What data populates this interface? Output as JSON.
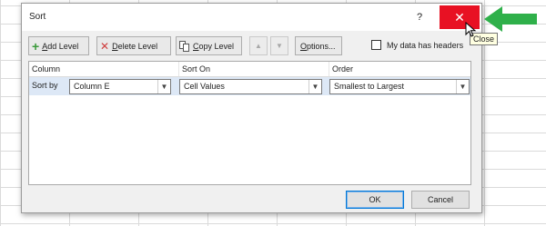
{
  "dialog": {
    "title": "Sort",
    "help_label": "?",
    "close_label": "✕"
  },
  "toolbar": {
    "add_level": {
      "underline": "A",
      "rest": "dd Level"
    },
    "delete_level": {
      "underline": "D",
      "rest": "elete Level"
    },
    "copy_level": {
      "underline": "C",
      "rest": "opy Level"
    },
    "move_up": "▲",
    "move_down": "▼",
    "options": {
      "underline": "O",
      "rest": "ptions..."
    },
    "headers_checkbox": {
      "pre": "My data has ",
      "underline": "h",
      "rest": "eaders",
      "checked": false
    }
  },
  "grid": {
    "columns": [
      "Column",
      "Sort On",
      "Order"
    ],
    "rows": [
      {
        "label": "Sort by",
        "column": "Column E",
        "sort_on": "Cell Values",
        "order": "Smallest to Largest"
      }
    ]
  },
  "footer": {
    "ok": "OK",
    "cancel": "Cancel"
  },
  "tooltip": "Close",
  "colors": {
    "close_bg": "#e81123",
    "selected_row": "#dde8f6",
    "annotation_arrow": "#2fb04a"
  }
}
